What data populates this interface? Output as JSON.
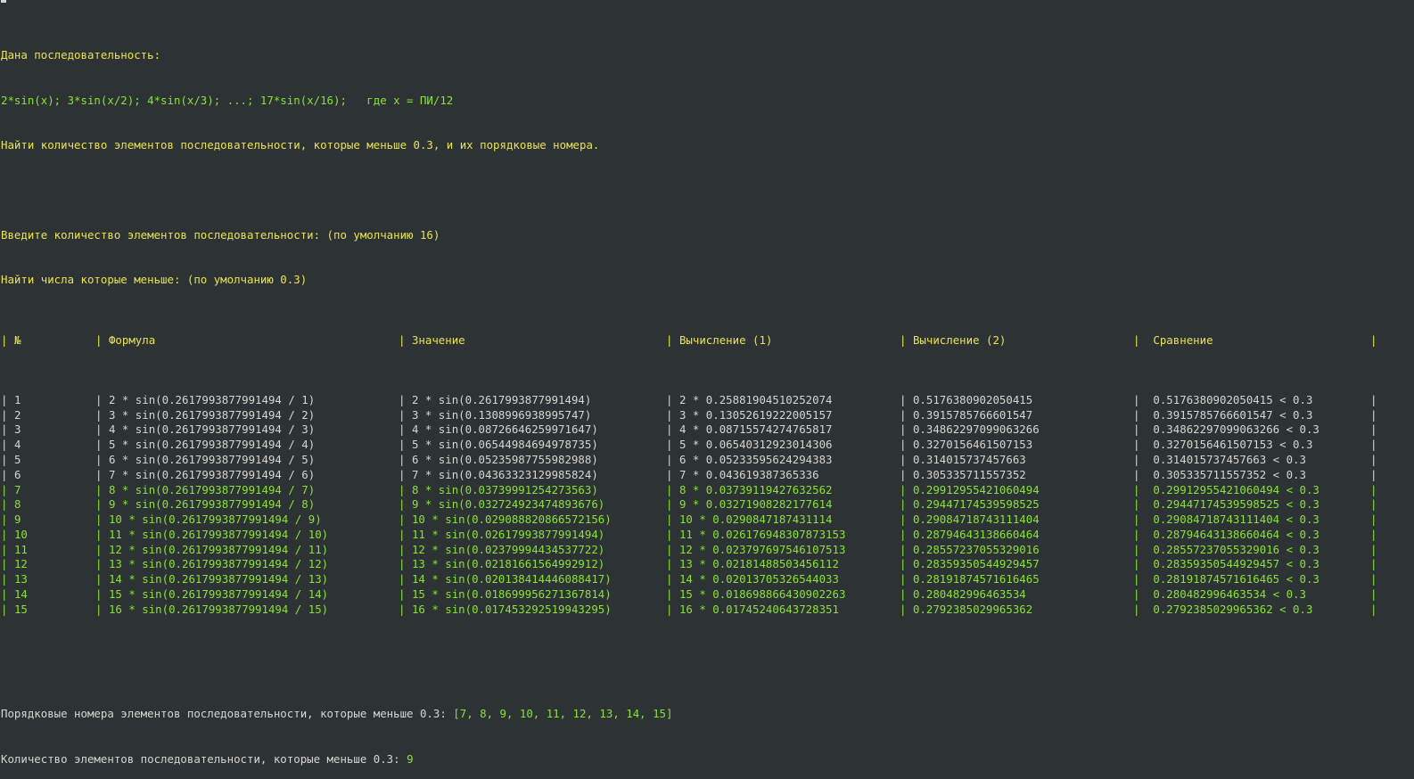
{
  "header": {
    "line1": "Дана последовательность:",
    "line2": "2*sin(x); 3*sin(x/2); 4*sin(x/3); ...; 17*sin(x/16);   где x = ПИ/12",
    "line3": "Найти количество элементов последовательности, которые меньше 0.3, и их порядковые номера.",
    "line5": "Введите количество элементов последовательности: (по умолчанию 16)",
    "line6": "Найти числа которые меньше: (по умолчанию 0.3)"
  },
  "table": {
    "separator": "|",
    "headers": [
      "№",
      "Формула",
      "Значение",
      "Вычисление (1)",
      "Вычисление (2)",
      "Сравнение"
    ],
    "rows": [
      {
        "n": "1",
        "formula": "2 * sin(0.2617993877991494 / 1)",
        "value": "2 * sin(0.2617993877991494)",
        "calc1": "2 * 0.25881904510252074",
        "calc2": "0.5176380902050415",
        "cmp": "0.5176380902050415 < 0.3",
        "match": false
      },
      {
        "n": "2",
        "formula": "3 * sin(0.2617993877991494 / 2)",
        "value": "3 * sin(0.1308996938995747)",
        "calc1": "3 * 0.13052619222005157",
        "calc2": "0.3915785766601547",
        "cmp": "0.3915785766601547 < 0.3",
        "match": false
      },
      {
        "n": "3",
        "formula": "4 * sin(0.2617993877991494 / 3)",
        "value": "4 * sin(0.08726646259971647)",
        "calc1": "4 * 0.08715574274765817",
        "calc2": "0.34862297099063266",
        "cmp": "0.34862297099063266 < 0.3",
        "match": false
      },
      {
        "n": "4",
        "formula": "5 * sin(0.2617993877991494 / 4)",
        "value": "5 * sin(0.06544984694978735)",
        "calc1": "5 * 0.06540312923014306",
        "calc2": "0.3270156461507153",
        "cmp": "0.3270156461507153 < 0.3",
        "match": false
      },
      {
        "n": "5",
        "formula": "6 * sin(0.2617993877991494 / 5)",
        "value": "6 * sin(0.05235987755982988)",
        "calc1": "6 * 0.05233595624294383",
        "calc2": "0.314015737457663",
        "cmp": "0.314015737457663 < 0.3",
        "match": false
      },
      {
        "n": "6",
        "formula": "7 * sin(0.2617993877991494 / 6)",
        "value": "7 * sin(0.04363323129985824)",
        "calc1": "7 * 0.043619387365336",
        "calc2": "0.305335711557352",
        "cmp": "0.305335711557352 < 0.3",
        "match": false
      },
      {
        "n": "7",
        "formula": "8 * sin(0.2617993877991494 / 7)",
        "value": "8 * sin(0.03739991254273563)",
        "calc1": "8 * 0.03739119427632562",
        "calc2": "0.29912955421060494",
        "cmp": "0.29912955421060494 < 0.3",
        "match": true
      },
      {
        "n": "8",
        "formula": "9 * sin(0.2617993877991494 / 8)",
        "value": "9 * sin(0.032724923474893676)",
        "calc1": "9 * 0.03271908282177614",
        "calc2": "0.29447174539598525",
        "cmp": "0.29447174539598525 < 0.3",
        "match": true
      },
      {
        "n": "9",
        "formula": "10 * sin(0.2617993877991494 / 9)",
        "value": "10 * sin(0.029088820866572156)",
        "calc1": "10 * 0.0290847187431114",
        "calc2": "0.29084718743111404",
        "cmp": "0.29084718743111404 < 0.3",
        "match": true
      },
      {
        "n": "10",
        "formula": "11 * sin(0.2617993877991494 / 10)",
        "value": "11 * sin(0.02617993877991494)",
        "calc1": "11 * 0.026176948307873153",
        "calc2": "0.28794643138660464",
        "cmp": "0.28794643138660464 < 0.3",
        "match": true
      },
      {
        "n": "11",
        "formula": "12 * sin(0.2617993877991494 / 11)",
        "value": "12 * sin(0.02379994434537722)",
        "calc1": "12 * 0.023797697546107513",
        "calc2": "0.28557237055329016",
        "cmp": "0.28557237055329016 < 0.3",
        "match": true
      },
      {
        "n": "12",
        "formula": "13 * sin(0.2617993877991494 / 12)",
        "value": "13 * sin(0.02181661564992912)",
        "calc1": "13 * 0.02181488503456112",
        "calc2": "0.28359350544929457",
        "cmp": "0.28359350544929457 < 0.3",
        "match": true
      },
      {
        "n": "13",
        "formula": "14 * sin(0.2617993877991494 / 13)",
        "value": "14 * sin(0.020138414446088417)",
        "calc1": "14 * 0.02013705326544033",
        "calc2": "0.28191874571616465",
        "cmp": "0.28191874571616465 < 0.3",
        "match": true
      },
      {
        "n": "14",
        "formula": "15 * sin(0.2617993877991494 / 14)",
        "value": "15 * sin(0.018699956271367814)",
        "calc1": "15 * 0.018698866430902263",
        "calc2": "0.280482996463534",
        "cmp": "0.280482996463534 < 0.3",
        "match": true
      },
      {
        "n": "15",
        "formula": "16 * sin(0.2617993877991494 / 15)",
        "value": "16 * sin(0.017453292519943295)",
        "calc1": "16 * 0.01745240643728351",
        "calc2": "0.2792385029965362",
        "cmp": "0.2792385029965362 < 0.3",
        "match": true
      }
    ]
  },
  "result": {
    "indices_label": "Порядковые номера элементов последовательности, которые меньше 0.3: ",
    "indices_value": "[7, 8, 9, 10, 11, 12, 13, 14, 15]",
    "count_label": "Количество элементов последовательности, которые меньше 0.3: ",
    "count_value": "9"
  },
  "colors": {
    "background": "#2d3234",
    "yellow": "#e9e34f",
    "green": "#8ae234",
    "white": "#d3d7cf"
  }
}
